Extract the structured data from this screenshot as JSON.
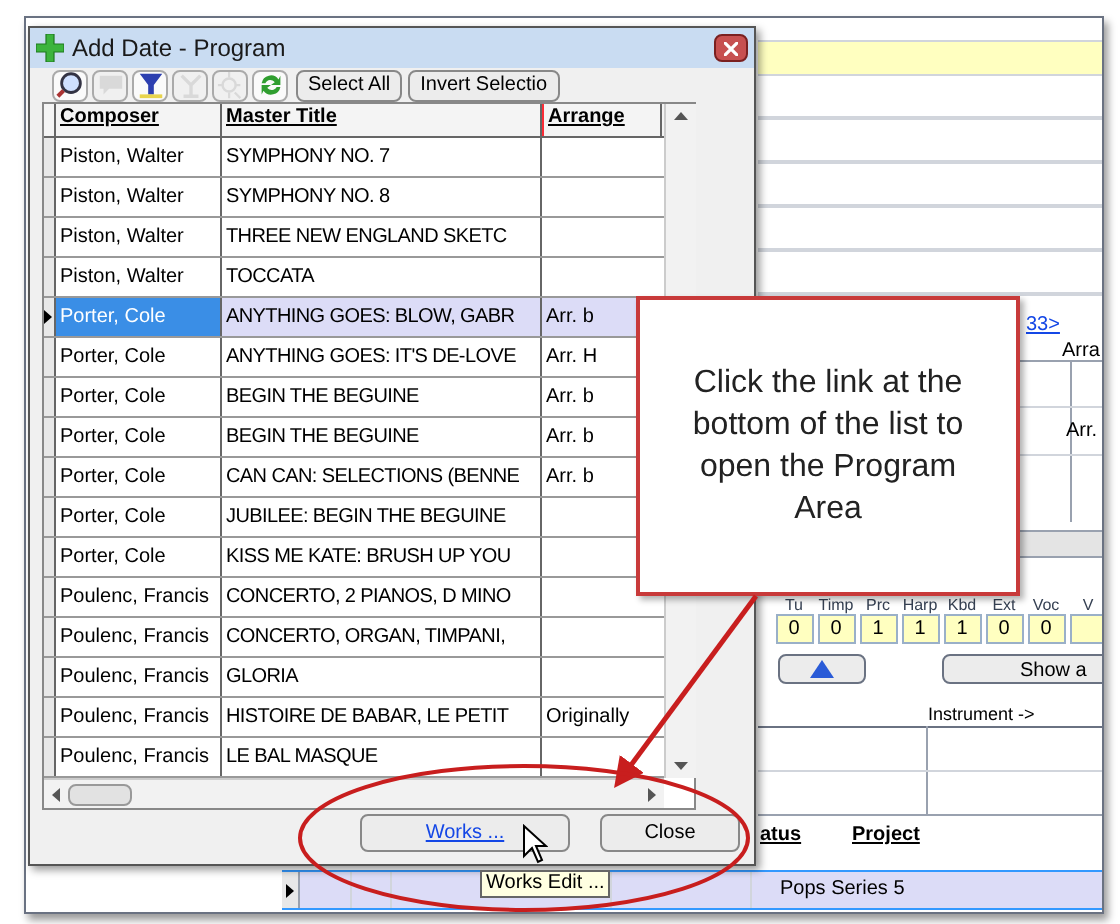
{
  "dialog": {
    "title": "Add Date - Program",
    "toolbar": [
      {
        "kind": "magnifier",
        "disabled": false
      },
      {
        "kind": "comment",
        "disabled": true
      },
      {
        "kind": "filter",
        "disabled": false
      },
      {
        "kind": "tool",
        "disabled": true
      },
      {
        "kind": "sparkle",
        "disabled": true
      },
      {
        "kind": "refresh",
        "disabled": false
      }
    ],
    "toolbar_buttons": [
      "Select All",
      "Invert Selectio"
    ],
    "columns": [
      "Composer",
      "Master Title",
      "Arrange"
    ],
    "rows": [
      {
        "composer": "Piston, Walter",
        "title": "SYMPHONY NO.  7",
        "selected": false
      },
      {
        "composer": "Piston, Walter",
        "title": "SYMPHONY NO.  8",
        "selected": false
      },
      {
        "composer": "Piston, Walter",
        "title": "THREE NEW ENGLAND SKETC",
        "selected": false
      },
      {
        "composer": "Piston, Walter",
        "title": "TOCCATA",
        "selected": false
      },
      {
        "composer": "Porter, Cole",
        "title": "ANYTHING GOES: BLOW, GABR",
        "arrangement": "Arr. b",
        "selected": true
      },
      {
        "composer": "Porter, Cole",
        "title": "ANYTHING GOES: IT'S DE-LOVE",
        "arrangement": "Arr. H",
        "selected": false
      },
      {
        "composer": "Porter, Cole",
        "title": "BEGIN THE BEGUINE",
        "arrangement": "Arr. b",
        "selected": false
      },
      {
        "composer": "Porter, Cole",
        "title": "BEGIN THE BEGUINE",
        "arrangement": "Arr. b",
        "selected": false
      },
      {
        "composer": "Porter, Cole",
        "title": "CAN CAN: SELECTIONS (BENNE",
        "arrangement": "Arr. b",
        "selected": false
      },
      {
        "composer": "Porter, Cole",
        "title": "JUBILEE: BEGIN THE BEGUINE",
        "selected": false
      },
      {
        "composer": "Porter, Cole",
        "title": "KISS ME KATE: BRUSH UP YOU",
        "selected": false
      },
      {
        "composer": "Poulenc, Francis",
        "title": "CONCERTO, 2 PIANOS, D MINO",
        "selected": false
      },
      {
        "composer": "Poulenc, Francis",
        "title": "CONCERTO, ORGAN, TIMPANI,",
        "selected": false
      },
      {
        "composer": "Poulenc, Francis",
        "title": "GLORIA",
        "selected": false
      },
      {
        "composer": "Poulenc, Francis",
        "title": "HISTOIRE DE BABAR, LE PETIT",
        "arrangement": "Originally",
        "selected": false
      },
      {
        "composer": "Poulenc, Francis",
        "title": "LE BAL MASQUE",
        "selected": false
      }
    ],
    "buttons": [
      {
        "label": "Works ...",
        "kind": "link"
      },
      {
        "label": "Close",
        "kind": "plain"
      }
    ],
    "tooltip": "Works Edit ..."
  },
  "callout": {
    "text": "Click the link at the bottom of the list to open the Program Area"
  },
  "background": {
    "link": "33>",
    "column_header": "Arra",
    "cell": "Arr.",
    "instruments": [
      {
        "label": "Tu",
        "value": "0"
      },
      {
        "label": "Timp",
        "value": "0"
      },
      {
        "label": "Prc",
        "value": "1"
      },
      {
        "label": "Harp",
        "value": "1"
      },
      {
        "label": "Kbd",
        "value": "1"
      },
      {
        "label": "Ext",
        "value": "0"
      },
      {
        "label": "Voc",
        "value": "0"
      },
      {
        "label": "V"
      }
    ],
    "show_button": "Show a",
    "instrument_header": "Instrument ->",
    "lower_columns": [
      "atus",
      "Project"
    ],
    "lower_row": {
      "project": "Pops Series 5",
      "selected": true
    }
  }
}
